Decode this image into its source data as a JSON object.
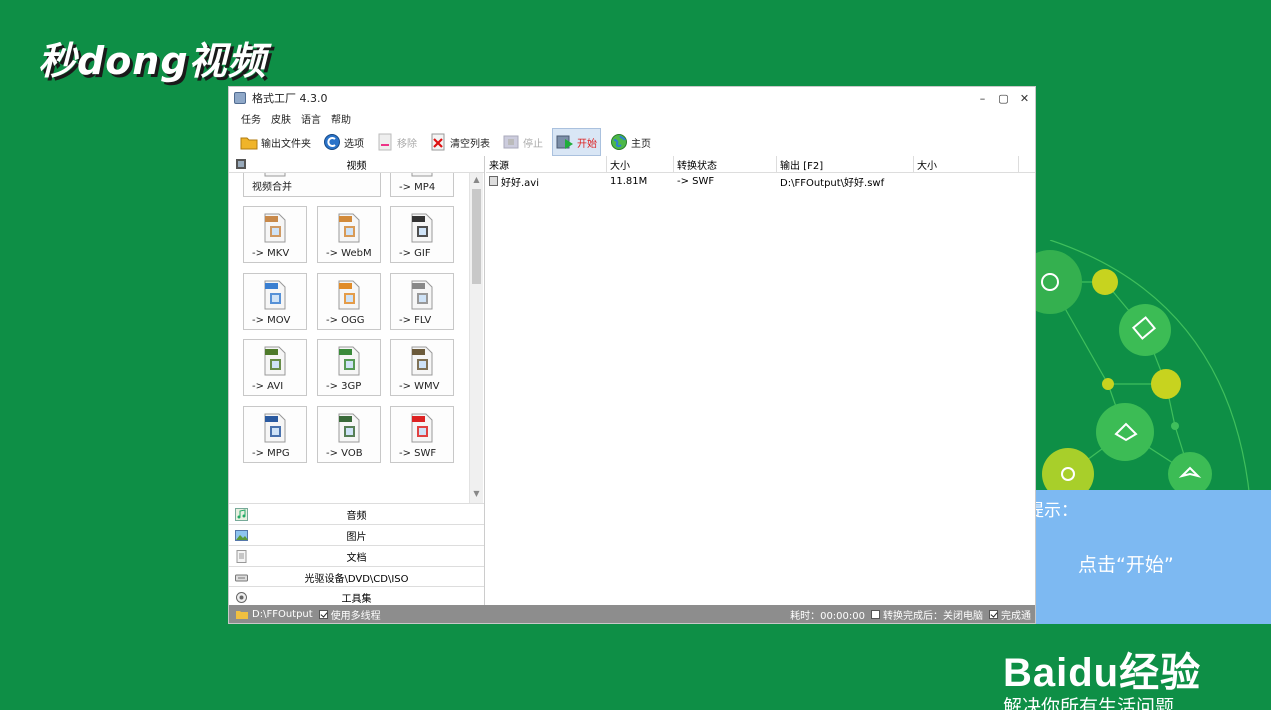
{
  "overlay": {
    "logo_text": "秒dong视频",
    "tip_title": "小提示：",
    "tip_body": "点击“开始”",
    "baidu_brand": "Baidu经验",
    "baidu_slogan": "解决你所有生活问题"
  },
  "window": {
    "title": "格式工厂 4.3.0",
    "buttons": {
      "minimize": "–",
      "maximize": "▢",
      "close": "✕"
    },
    "menu": [
      "任务",
      "皮肤",
      "语言",
      "帮助"
    ],
    "toolbar": {
      "output_folder": "输出文件夹",
      "options": "选项",
      "remove": "移除",
      "clear_list": "清空列表",
      "stop": "停止",
      "start": "开始",
      "home": "主页"
    },
    "left": {
      "video_header": "视频",
      "tiles": [
        {
          "label": "视频合并",
          "icon": "merge-icon"
        },
        {
          "label": "-> MP4",
          "icon": "mp4-icon"
        },
        {
          "label": "-> MKV",
          "icon": "mkv-icon"
        },
        {
          "label": "-> WebM",
          "icon": "webm-icon"
        },
        {
          "label": "-> GIF",
          "icon": "gif-icon"
        },
        {
          "label": "-> MOV",
          "icon": "mov-icon"
        },
        {
          "label": "-> OGG",
          "icon": "ogg-icon"
        },
        {
          "label": "-> FLV",
          "icon": "flv-icon"
        },
        {
          "label": "-> AVI",
          "icon": "avi-icon"
        },
        {
          "label": "-> 3GP",
          "icon": "3gp-icon"
        },
        {
          "label": "-> WMV",
          "icon": "wmv-icon"
        },
        {
          "label": "-> MPG",
          "icon": "mpg-icon"
        },
        {
          "label": "-> VOB",
          "icon": "vob-icon"
        },
        {
          "label": "-> SWF",
          "icon": "swf-icon"
        }
      ],
      "categories": [
        "音频",
        "图片",
        "文档",
        "光驱设备\\DVD\\CD\\ISO",
        "工具集"
      ]
    },
    "table": {
      "headers": [
        "来源",
        "大小",
        "转换状态",
        "输出 [F2]",
        "大小"
      ],
      "rows": [
        {
          "source": "好好.avi",
          "size": "11.81M",
          "status": "-> SWF",
          "output": "D:\\FFOutput\\好好.swf",
          "out_size": ""
        }
      ]
    },
    "status": {
      "output_path": "D:\\FFOutput",
      "multithread": "使用多线程",
      "elapsed": "耗时：00:00:00",
      "after_done": "转换完成后：关闭电脑",
      "notify": "完成通"
    }
  }
}
